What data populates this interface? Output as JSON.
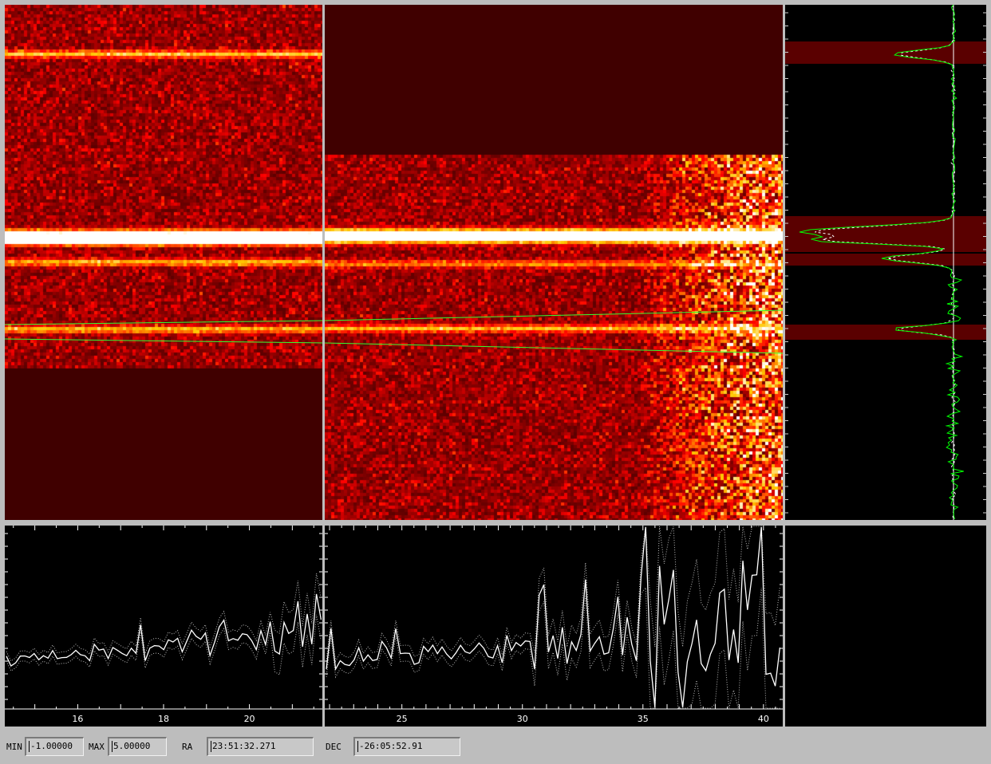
{
  "controls": {
    "min_label": "MIN",
    "min_value": "-1.00000",
    "max_label": "MAX",
    "max_value": "5.00000",
    "ra_label": "RA",
    "ra_value": "23:51:32.271",
    "dec_label": "DEC",
    "dec_value": "-26:05:52.91"
  },
  "colors": {
    "background": "#bdbdbd",
    "trace": "#00ff00",
    "profile_band": "#5a0000",
    "empty_region": "#400000"
  },
  "spectrum_left": {
    "x_ticks": [
      "16",
      "18",
      "20"
    ],
    "xlim": [
      14.3,
      21.7
    ]
  },
  "spectrum_right": {
    "x_ticks": [
      "25",
      "30",
      "35",
      "40"
    ],
    "xlim": [
      21.8,
      40.8
    ]
  }
}
